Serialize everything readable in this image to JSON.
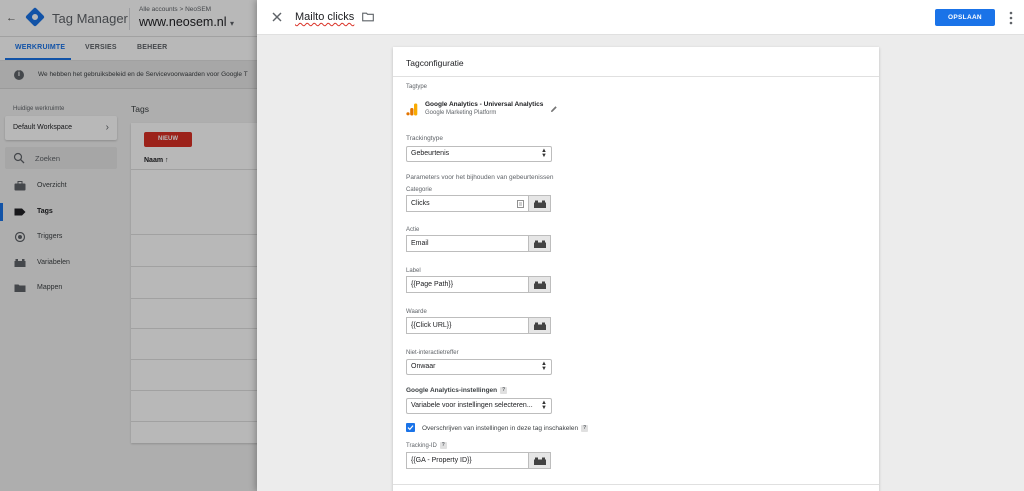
{
  "app": {
    "back_icon": "arrow-left-icon",
    "product": "Tag Manager",
    "breadcrumb": "Alle accounts > NeoSEM",
    "container": "www.neosem.nl",
    "container_dropdown_icon": "caret-down-icon",
    "nav_tabs": [
      {
        "label": "WERKRUIMTE",
        "active": true
      },
      {
        "label": "VERSIES",
        "active": false
      },
      {
        "label": "BEHEER",
        "active": false
      }
    ],
    "notice_text": "We hebben het gebruiksbeleid en de Servicevoorwaarden voor Google T",
    "workspace_label": "Huidige werkruimte",
    "workspace_name": "Default Workspace",
    "search_placeholder": "Zoeken",
    "sidebar_items": [
      {
        "label": "Overzicht",
        "icon": "briefcase-icon",
        "active": false
      },
      {
        "label": "Tags",
        "icon": "tag-icon",
        "active": true
      },
      {
        "label": "Triggers",
        "icon": "trigger-icon",
        "active": false
      },
      {
        "label": "Variabelen",
        "icon": "variables-icon",
        "active": false
      },
      {
        "label": "Mappen",
        "icon": "folder-icon",
        "active": false
      }
    ],
    "tags_title": "Tags",
    "new_button": "NIEUW",
    "name_column": "Naam",
    "sort_icon": "arrow-up-icon"
  },
  "panel": {
    "title": "Mailto clicks",
    "save_label": "OPSLAAN",
    "card_title": "Tagconfiguratie",
    "tagtype_label": "Tagtype",
    "tagtype_name": "Google Analytics - Universal Analytics",
    "tagtype_sub": "Google Marketing Platform",
    "trackingtype_label": "Trackingtype",
    "trackingtype_value": "Gebeurtenis",
    "params_label": "Parameters voor het bijhouden van gebeurtenissen",
    "fields": [
      {
        "label": "Categorie",
        "value": "Clicks"
      },
      {
        "label": "Actie",
        "value": "Email"
      },
      {
        "label": "Label",
        "value": "{{Page Path}}"
      },
      {
        "label": "Waarde",
        "value": "{{Click URL}}"
      }
    ],
    "noninteraction_label": "Niet-interactietreffer",
    "noninteraction_value": "Onwaar",
    "ga_settings_label": "Google Analytics-instellingen",
    "ga_settings_value": "Variabele voor instellingen selecteren...",
    "override_label": "Overschrijven van instellingen in deze tag inschakelen",
    "override_checked": true,
    "tracking_id_label": "Tracking-ID",
    "tracking_id_value": "{{GA - Property ID}}",
    "help_glyph": "?"
  },
  "colors": {
    "accent": "#1a73e8",
    "new_button": "#d93025",
    "ga_orange": "#f9ab00"
  }
}
